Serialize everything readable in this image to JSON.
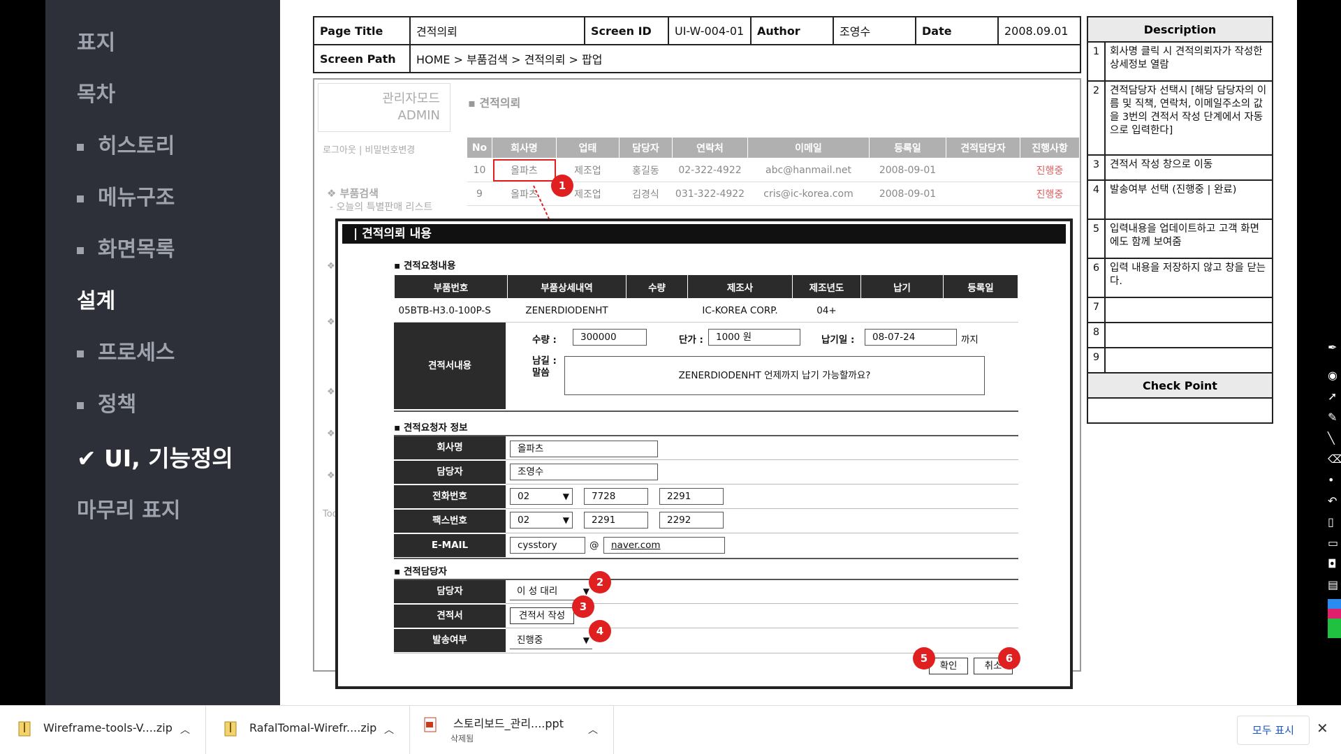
{
  "nav": {
    "items": [
      {
        "label": "표지"
      },
      {
        "label": "목차"
      },
      {
        "label": "히스토리"
      },
      {
        "label": "메뉴구조"
      },
      {
        "label": "화면목록"
      },
      {
        "label": "설계"
      },
      {
        "label": "프로세스"
      },
      {
        "label": "정책"
      },
      {
        "label": "✔ UI, 기능정의"
      },
      {
        "label": "마무리 표지"
      }
    ]
  },
  "header": {
    "page_title_label": "Page Title",
    "page_title_value": "견적의뢰",
    "screen_id_label": "Screen ID",
    "screen_id_value": "UI-W-004-01",
    "author_label": "Author",
    "author_value": "조영수",
    "date_label": "Date",
    "date_value": "2008.09.01",
    "screen_path_label": "Screen Path",
    "screen_path_value": "HOME > 부품검색 > 견적의뢰 > 팝업"
  },
  "description": {
    "title": "Description",
    "items": [
      {
        "n": "1",
        "text": "회사명 클릭 시 견적의뢰자가 작성한 상세정보 열람"
      },
      {
        "n": "2",
        "text": "견적담당자 선택시 [해당 담당자의 이름 및 직책, 연락처, 이메일주소의 값을 3번의 견적서 작성 단계에서 자동으로 입력한다]"
      },
      {
        "n": "3",
        "text": "견적서 작성 창으로 이동"
      },
      {
        "n": "4",
        "text": "발송여부 선택 (진행중 | 완료)"
      },
      {
        "n": "5",
        "text": "입력내용을 업데이트하고 고객 화면에도 함께 보여줌"
      },
      {
        "n": "6",
        "text": "입력 내용을 저장하지 않고 창을 닫는다."
      },
      {
        "n": "7",
        "text": ""
      },
      {
        "n": "8",
        "text": ""
      },
      {
        "n": "9",
        "text": ""
      }
    ],
    "check_point": "Check Point"
  },
  "admin": {
    "mode_line1": "관리자모드",
    "mode_line2": "ADMIN",
    "logout": "로그아웃 | 비밀번호변경",
    "section": "▪ 견적의뢰",
    "menu_title": "❖ 부품검색",
    "menu_sub": "- 오늘의 특별판매 리스트",
    "tod": "Tod"
  },
  "list": {
    "headers": [
      "No",
      "회사명",
      "업태",
      "담당자",
      "연락처",
      "이메일",
      "등록일",
      "견적담당자",
      "진행사항"
    ],
    "rows": [
      [
        "10",
        "올파츠",
        "제조업",
        "홍길동",
        "02-322-4922",
        "abc@hanmail.net",
        "2008-09-01",
        "",
        "진행중"
      ],
      [
        "9",
        "올파츠",
        "제조업",
        "김경식",
        "031-322-4922",
        "cris@ic-korea.com",
        "2008-09-01",
        "",
        "진행중"
      ]
    ]
  },
  "modal": {
    "title": "| 견적의뢰 내용",
    "req_section": "▪ 견적요청내용",
    "req_headers": [
      "부품번호",
      "부품상세내역",
      "수량",
      "제조사",
      "제조년도",
      "납기",
      "등록일"
    ],
    "req_row": [
      "05BTB-H3.0-100P-S",
      "ZENERDIODENHT",
      "",
      "IC-KOREA CORP.",
      "04+",
      "",
      ""
    ],
    "quote_label": "견적서내용",
    "qty_label": "수량 :",
    "qty_value": "300000",
    "price_label": "단가 :",
    "price_value": "1000 원",
    "due_label": "납기일 :",
    "due_value": "08-07-24",
    "due_suffix": "까지",
    "note_label": "남길 :\n말씀",
    "note_value": "ZENERDIODENHT 언제까지 납기 가능할까요?",
    "requester_section": "▪ 견적요청자 정보",
    "company_label": "회사명",
    "company_value": "올파츠",
    "person_label": "담당자",
    "person_value": "조영수",
    "phone_label": "전화번호",
    "phone": [
      "02",
      "7728",
      "2291"
    ],
    "fax_label": "팩스번호",
    "fax": [
      "02",
      "2291",
      "2292"
    ],
    "email_label": "E-MAIL",
    "email_user": "cysstory",
    "email_at": "@",
    "email_domain": "naver.com",
    "manager_section": "▪ 견적담당자",
    "manager_label": "담당자",
    "manager_value": "이 성 대리",
    "quote_doc_label": "견적서",
    "quote_doc_button": "견적서 작성",
    "send_label": "발송여부",
    "send_value": "진행중",
    "ok_button": "확인",
    "cancel_button": "취소"
  },
  "badges": [
    "1",
    "2",
    "3",
    "4",
    "5",
    "6"
  ],
  "taskbar": {
    "downloads": [
      {
        "name": "Wireframe-tools-V....zip",
        "sub": ""
      },
      {
        "name": "RafalTomal-Wirefr....zip",
        "sub": ""
      },
      {
        "name": "스토리보드_관리....ppt",
        "sub": "삭제됨"
      }
    ],
    "show_all": "모두 표시",
    "close": "✕"
  },
  "colors": {
    "badge": "#e02020",
    "nav_bg": "#2d3038",
    "link": "#1a57c8"
  }
}
